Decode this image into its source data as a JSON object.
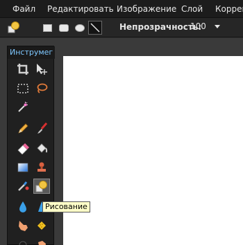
{
  "menu": {
    "items": [
      {
        "label": "Файл"
      },
      {
        "label": "Редактировать"
      },
      {
        "label": "Изображение"
      },
      {
        "label": "Слой"
      },
      {
        "label": "Коррекц"
      }
    ]
  },
  "options_bar": {
    "opacity_label": "Непрозрачность:",
    "opacity_value": "100"
  },
  "tools_panel": {
    "title": "Инструмег"
  },
  "tooltip": {
    "text": "Рисование"
  },
  "colors": {
    "panel_title": "#7fc8ff",
    "tooltip_bg": "#ffffc8"
  }
}
